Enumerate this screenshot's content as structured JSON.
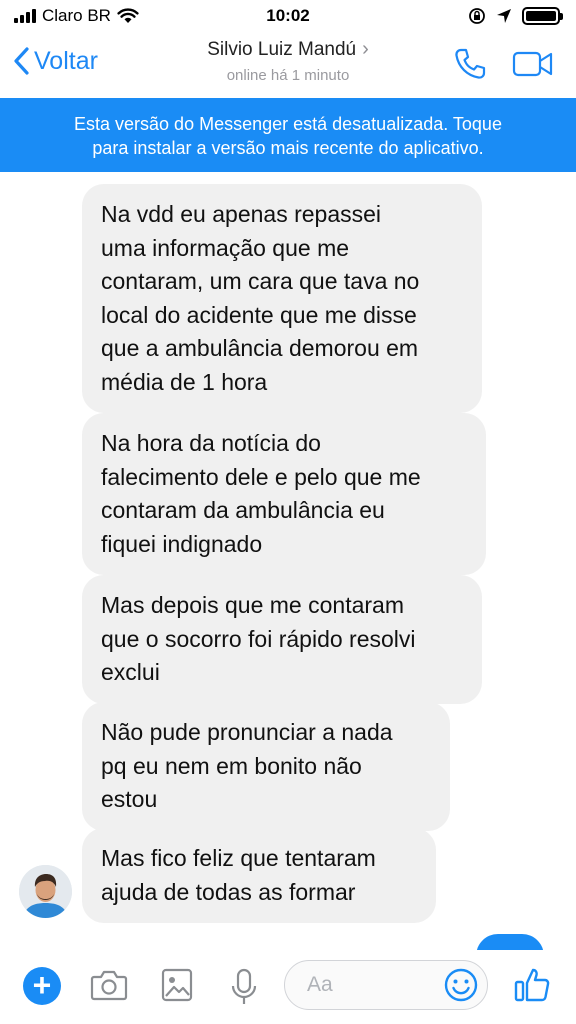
{
  "status_bar": {
    "carrier": "Claro BR",
    "time": "10:02",
    "icons": [
      "signal-icon",
      "wifi-icon",
      "rotation-lock-icon",
      "location-icon",
      "battery-icon"
    ]
  },
  "nav": {
    "back_label": "Voltar",
    "contact_name": "Silvio Luiz Mandú",
    "contact_status": "online há 1 minuto",
    "icons": [
      "chevron-left-icon",
      "chevron-right-icon",
      "phone-icon",
      "video-camera-icon"
    ]
  },
  "banner": {
    "line1": "Esta versão do Messenger está desatualizada. Toque",
    "line2": "para instalar a versão mais recente do aplicativo."
  },
  "messages": [
    {
      "lines": [
        "Na vdd eu apenas repassei",
        "uma informação que me",
        "contaram, um cara que tava no",
        "local do acidente que me disse",
        "que a ambulância demorou em",
        "média de 1 hora"
      ]
    },
    {
      "lines": [
        "Na hora da notícia do",
        "falecimento dele e pelo que me",
        "contaram da ambulância eu",
        "fiquei indignado"
      ]
    },
    {
      "lines": [
        "Mas depois que me contaram",
        "que o socorro foi rápido resolvi",
        "exclui"
      ]
    },
    {
      "lines": [
        "Não pude pronunciar a nada",
        "pq eu nem em bonito não",
        "estou"
      ]
    },
    {
      "lines": [
        "Mas fico feliz que tentaram",
        "ajuda de todas as formar"
      ]
    }
  ],
  "composer": {
    "placeholder": "Aa",
    "icons": [
      "plus-icon",
      "camera-icon",
      "image-icon",
      "microphone-icon",
      "emoji-icon",
      "thumbs-up-icon"
    ]
  },
  "colors": {
    "accent": "#1a8cf5",
    "bubble": "#f0f0f0",
    "muted": "#9a9a9f"
  }
}
